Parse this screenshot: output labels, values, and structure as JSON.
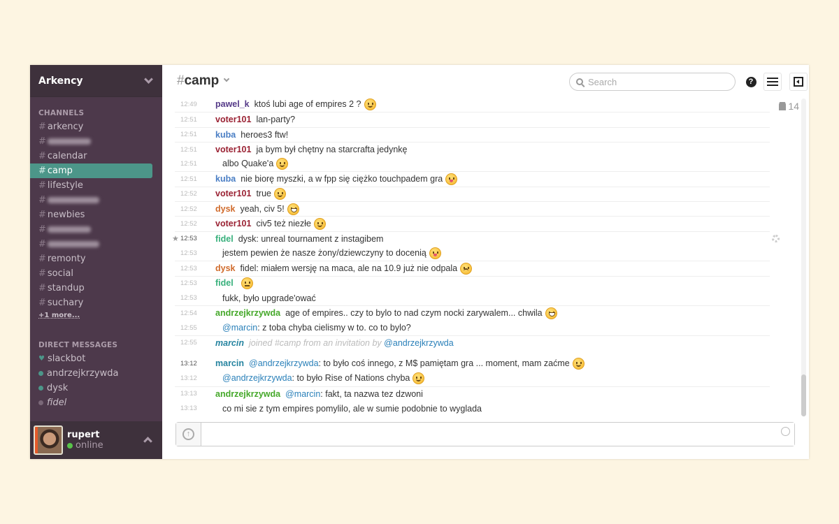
{
  "team": {
    "name": "Arkency"
  },
  "channels": {
    "label": "CHANNELS",
    "items": [
      {
        "name": "arkency"
      },
      {
        "blurred": true
      },
      {
        "name": "calendar"
      },
      {
        "name": "camp",
        "active": true
      },
      {
        "name": "lifestyle"
      },
      {
        "blurred": true
      },
      {
        "name": "newbies"
      },
      {
        "blurred": true
      },
      {
        "blurred": true
      },
      {
        "name": "remonty"
      },
      {
        "name": "social"
      },
      {
        "name": "standup"
      },
      {
        "name": "suchary"
      }
    ],
    "more": "+1 more..."
  },
  "dms": {
    "label": "DIRECT MESSAGES",
    "items": [
      {
        "name": "slackbot",
        "icon": "heart-icon"
      },
      {
        "name": "andrzejkrzywda",
        "status": "online"
      },
      {
        "name": "dysk",
        "status": "online"
      },
      {
        "name": "fidel",
        "status": "away",
        "italic": true
      }
    ]
  },
  "me": {
    "name": "rupert",
    "status": "online"
  },
  "header": {
    "hash": "#",
    "channel": "camp",
    "search_placeholder": "Search",
    "members": "14"
  },
  "colors": {
    "pawel_k": "#553a88",
    "voter101": "#9a2233",
    "kuba": "#4a7ec4",
    "dysk": "#d06b2c",
    "fidel": "#38b07c",
    "andrzejkrzywda": "#45a82a",
    "marcin": "#2684a0",
    "sidebar": "#4d394b",
    "active": "#4c9689"
  },
  "messages": [
    {
      "time": "12:49",
      "user": "pawel_k",
      "parts": [
        {
          "t": "ktoś lubi age of empires 2 ?"
        }
      ],
      "emoji": "wink"
    },
    {
      "time": "12:51",
      "user": "voter101",
      "parts": [
        {
          "t": "lan-party?"
        }
      ]
    },
    {
      "time": "12:51",
      "user": "kuba",
      "parts": [
        {
          "t": "heroes3 ftw!"
        }
      ]
    },
    {
      "time": "12:51",
      "user": "voter101",
      "parts": [
        {
          "t": "ja bym był chętny na starcrafta jedynkę"
        }
      ]
    },
    {
      "time": "12:51",
      "parts": [
        {
          "t": "albo Quake'a"
        }
      ],
      "emoji": "wink"
    },
    {
      "time": "12:51",
      "user": "kuba",
      "parts": [
        {
          "t": "nie biorę myszki, a w fpp się ciężko touchpadem gra"
        }
      ],
      "emoji": "tongue"
    },
    {
      "time": "12:52",
      "user": "voter101",
      "parts": [
        {
          "t": "true"
        }
      ],
      "emoji": "wink"
    },
    {
      "time": "12:52",
      "user": "dysk",
      "parts": [
        {
          "t": "yeah, civ 5!"
        }
      ],
      "emoji": "grin"
    },
    {
      "time": "12:52",
      "user": "voter101",
      "parts": [
        {
          "t": "civ5 też niezłe"
        }
      ],
      "emoji": "wink"
    },
    {
      "time": "12:53",
      "user": "fidel",
      "starred": true,
      "gear": true,
      "parts": [
        {
          "t": "dysk: unreal tournament z instagibem"
        }
      ]
    },
    {
      "time": "12:53",
      "parts": [
        {
          "t": "jestem pewien że nasze żony/dziewczyny to docenią"
        }
      ],
      "emoji": "tongue"
    },
    {
      "time": "12:53",
      "user": "dysk",
      "parts": [
        {
          "t": "fidel: miałem wersję na maca, ale na 10.9 już nie odpala"
        }
      ],
      "emoji": "sad"
    },
    {
      "time": "12:53",
      "user": "fidel",
      "parts": [],
      "emoji": "neutral"
    },
    {
      "time": "12:53",
      "parts": [
        {
          "t": "fukk, było upgrade'ować"
        }
      ]
    },
    {
      "time": "12:54",
      "user": "andrzejkrzywda",
      "parts": [
        {
          "t": "age of empires.. czy to bylo to nad czym nocki zarywalem... chwila"
        }
      ],
      "emoji": "grin"
    },
    {
      "time": "12:55",
      "parts": [
        {
          "m": "@marcin"
        },
        {
          "t": ": z toba chyba cielismy w to. co to bylo?"
        }
      ]
    },
    {
      "time": "12:55",
      "user": "marcin",
      "system": true,
      "parts": [
        {
          "s": "joined #camp from an invitation by "
        },
        {
          "m": "@andrzejkrzywda"
        }
      ]
    },
    {
      "time": "13:12",
      "user": "marcin",
      "gap": true,
      "dark": true,
      "parts": [
        {
          "m": "@andrzejkrzywda"
        },
        {
          "t": ": to było coś innego, z M$ pamiętam gra ... moment, mam zaćme"
        }
      ],
      "emoji": "wink"
    },
    {
      "time": "13:12",
      "parts": [
        {
          "m": "@andrzejkrzywda"
        },
        {
          "t": ": to było Rise of Nations chyba"
        }
      ],
      "emoji": "wink"
    },
    {
      "time": "13:13",
      "user": "andrzejkrzywda",
      "parts": [
        {
          "m": "@marcin"
        },
        {
          "t": ": fakt, ta nazwa tez dzwoni"
        }
      ]
    },
    {
      "time": "13:13",
      "parts": [
        {
          "t": "co mi sie z tym empires pomylilo, ale w sumie podobnie to wyglada"
        }
      ]
    }
  ]
}
